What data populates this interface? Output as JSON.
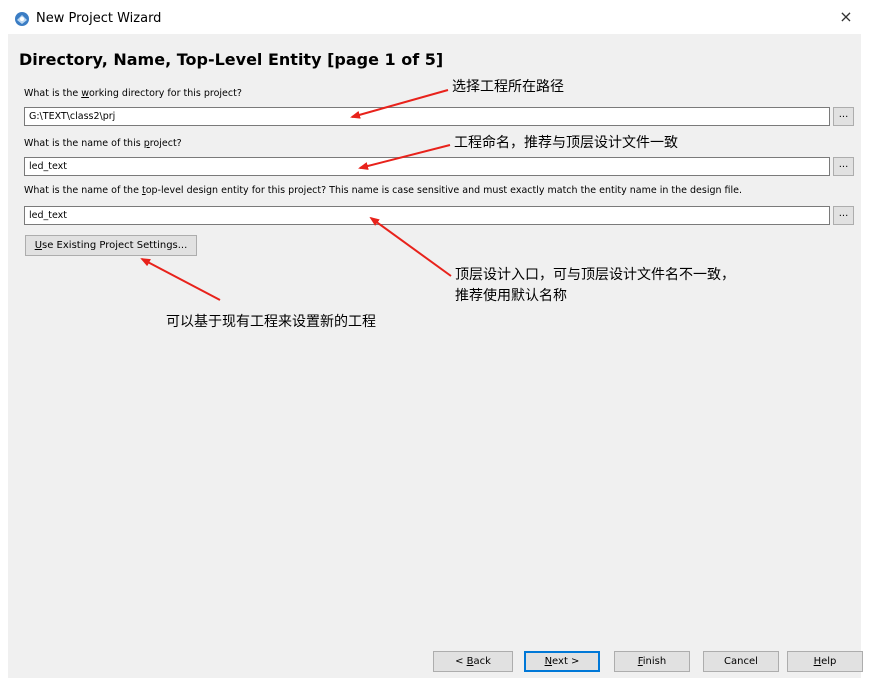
{
  "window": {
    "title": "New Project Wizard",
    "close_glyph": "×",
    "icon": "quartus-wizard-icon"
  },
  "page": {
    "heading": "Directory, Name, Top-Level Entity [page 1 of 5]"
  },
  "fields": {
    "directory": {
      "label_pre": "What is the ",
      "label_mnemonic": "w",
      "label_post": "orking directory for this project?",
      "value": "G:\\TEXT\\class2\\prj",
      "browse_label": "..."
    },
    "project_name": {
      "label_pre": "What is the name of this ",
      "label_mnemonic": "p",
      "label_post": "roject?",
      "value": "led_text",
      "browse_label": "..."
    },
    "top_entity": {
      "label_pre": "What is the name of the ",
      "label_mnemonic": "t",
      "label_post": "op-level design entity for this project? This name is case sensitive and must exactly match the entity name in the design file.",
      "value": "led_text",
      "browse_label": "..."
    }
  },
  "use_existing": {
    "mnemonic": "U",
    "rest": "se Existing Project Settings..."
  },
  "annotations": {
    "directory": "选择工程所在路径",
    "project_name": "工程命名，推荐与顶层设计文件一致",
    "top_entity_line1": "顶层设计入口，可与顶层设计文件名不一致，",
    "top_entity_line2": "推荐使用默认名称",
    "use_existing": "可以基于现有工程来设置新的工程"
  },
  "footer": {
    "back": {
      "pre": "< ",
      "mnemonic": "B",
      "post": "ack"
    },
    "next": {
      "pre": "",
      "mnemonic": "N",
      "post": "ext >"
    },
    "finish": {
      "pre": "",
      "mnemonic": "F",
      "post": "inish"
    },
    "cancel": {
      "label": "Cancel"
    },
    "help": {
      "pre": "",
      "mnemonic": "H",
      "post": "elp"
    }
  },
  "colors": {
    "dialog_bg": "#f0f0f0",
    "arrow": "#e8221b",
    "default_button_border": "#0078d7"
  }
}
